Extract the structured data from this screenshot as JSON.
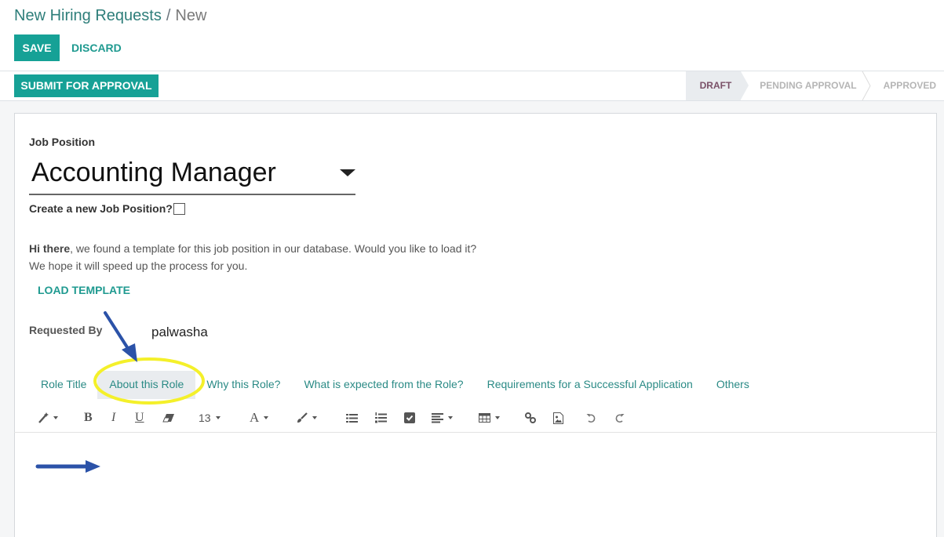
{
  "breadcrumb": {
    "parent": "New Hiring Requests",
    "separator": "/",
    "current": "New"
  },
  "actions": {
    "save": "SAVE",
    "discard": "DISCARD"
  },
  "statusbar": {
    "submit": "SUBMIT FOR APPROVAL",
    "stages": [
      {
        "label": "DRAFT",
        "active": true
      },
      {
        "label": "PENDING APPROVAL",
        "active": false
      },
      {
        "label": "APPROVED",
        "active": false
      }
    ]
  },
  "form": {
    "job_position_label": "Job Position",
    "job_position_value": "Accounting Manager",
    "create_new_label": "Create a new Job Position?",
    "create_new_checked": false,
    "template_msg_bold": "Hi there",
    "template_msg_rest": ", we found a template for this job position in our database. Would you like to load it?",
    "template_msg_line2": "We hope it will speed up the process for you.",
    "load_template": "LOAD TEMPLATE",
    "requested_by_label": "Requested By",
    "requested_by_value": "palwasha"
  },
  "tabs": [
    {
      "label": "Role Title",
      "active": false
    },
    {
      "label": "About this Role",
      "active": true
    },
    {
      "label": "Why this Role?",
      "active": false
    },
    {
      "label": "What is expected from the Role?",
      "active": false
    },
    {
      "label": "Requirements for a Successful Application",
      "active": false
    },
    {
      "label": "Others",
      "active": false
    }
  ],
  "editor": {
    "font_size": "13",
    "toolbar_icons": [
      "magic-wand-icon",
      "bold-icon",
      "italic-icon",
      "underline-icon",
      "eraser-icon",
      "font-size-dropdown",
      "font-color-icon",
      "paint-brush-icon",
      "bullet-list-icon",
      "numbered-list-icon",
      "checklist-icon",
      "align-icon",
      "table-icon",
      "link-icon",
      "image-icon",
      "undo-icon",
      "redo-icon"
    ],
    "content": ""
  },
  "colors": {
    "primary": "#16a196",
    "link": "#1f9a90",
    "annotation_arrow": "#2b52a8",
    "annotation_highlight": "#f4f02a",
    "stage_active_text": "#7a5168"
  }
}
